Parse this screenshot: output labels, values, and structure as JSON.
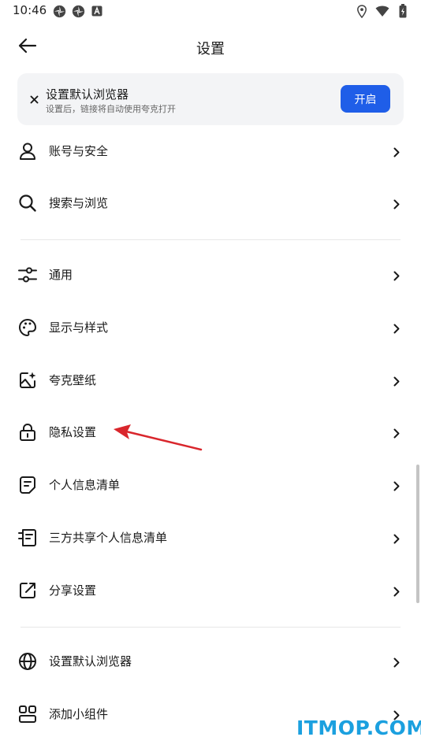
{
  "status_bar": {
    "time": "10:46",
    "left_icons": [
      "pinwheel-icon",
      "pinwheel-icon",
      "a-notification-icon"
    ],
    "right_icons": [
      "location-icon",
      "wifi-icon",
      "battery-icon"
    ]
  },
  "header": {
    "title": "设置",
    "back_icon": "back-arrow-icon"
  },
  "banner": {
    "close_icon": "close-icon",
    "title": "设置默认浏览器",
    "subtitle": "设置后，链接将自动使用夸克打开",
    "button_label": "开启",
    "button_color": "#1f5ee8"
  },
  "menu": {
    "groups": [
      [
        {
          "icon": "user-icon",
          "label": "账号与安全"
        },
        {
          "icon": "search-icon",
          "label": "搜索与浏览"
        }
      ],
      [
        {
          "icon": "sliders-icon",
          "label": "通用"
        },
        {
          "icon": "palette-icon",
          "label": "显示与样式"
        },
        {
          "icon": "wallpaper-icon",
          "label": "夸克壁纸"
        },
        {
          "icon": "lock-icon",
          "label": "隐私设置"
        },
        {
          "icon": "document-icon",
          "label": "个人信息清单"
        },
        {
          "icon": "shared-document-icon",
          "label": "三方共享个人信息清单"
        },
        {
          "icon": "share-icon",
          "label": "分享设置"
        }
      ],
      [
        {
          "icon": "globe-icon",
          "label": "设置默认浏览器"
        },
        {
          "icon": "widget-icon",
          "label": "添加小组件"
        }
      ]
    ]
  },
  "annotation": {
    "color": "#d9262c",
    "points_to": "隐私设置"
  },
  "watermark": {
    "text": "ITMOP.COM",
    "color": "#1ba0df"
  }
}
